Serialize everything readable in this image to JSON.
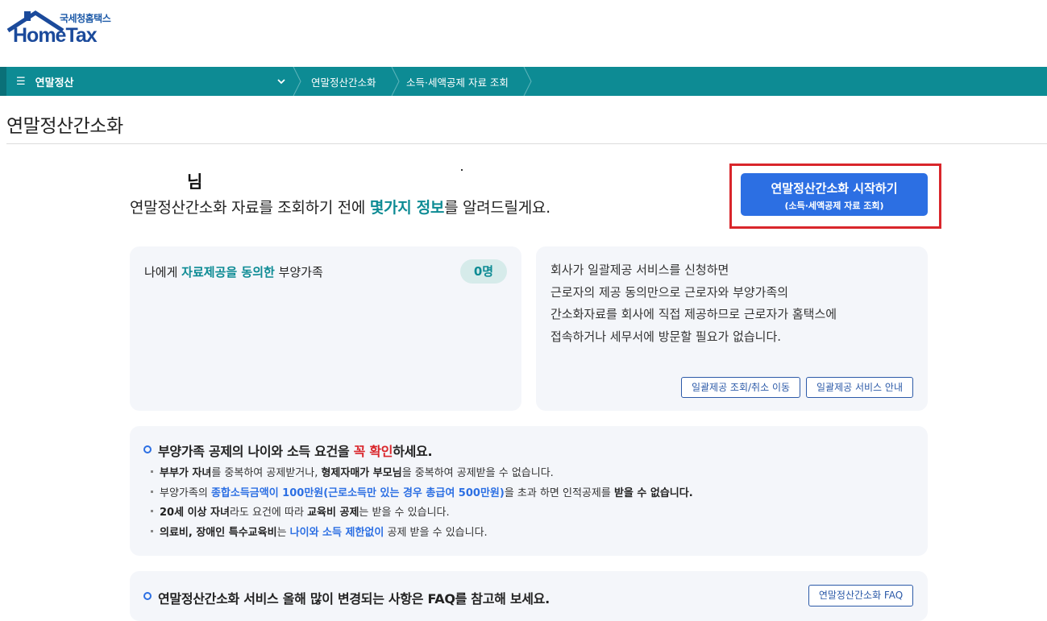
{
  "header": {
    "logo_sub": "국세청홈택스",
    "logo_main": "HomeTax"
  },
  "nav": {
    "menu_label": "연말정산",
    "breadcrumbs": [
      "연말정산간소화",
      "소득·세액공제 자료 조회"
    ]
  },
  "page": {
    "title": "연말정산간소화"
  },
  "greeting": {
    "name_suffix": "님",
    "line_pre": "연말정산간소화 자료를 조회하기 전에 ",
    "line_highlight": "몇가지 정보",
    "line_post": "를 알려드릴게요."
  },
  "start_button": {
    "label": "연말정산간소화 시작하기",
    "sublabel": "(소득·세액공제 자료 조회)"
  },
  "consent_card": {
    "label_pre": "나에게 ",
    "label_highlight": "자료제공을 동의한",
    "label_post": " 부양가족",
    "count": "0명"
  },
  "batch_card": {
    "lines": [
      "회사가 일괄제공 서비스를 신청하면",
      "근로자의 제공 동의만으로 근로자와 부양가족의",
      "간소화자료를 회사에 직접 제공하므로 근로자가 홈택스에",
      "접속하거나 세무서에 방문할 필요가 없습니다."
    ],
    "btn_query": "일괄제공 조회/취소 이동",
    "btn_guide": "일괄제공 서비스 안내"
  },
  "notice": {
    "title_pre": "부양가족 공제의 나이와 소득 요건을 ",
    "title_red": "꼭 확인",
    "title_post": "하세요.",
    "bullets": [
      {
        "b1": "부부가 자녀",
        "t1": "를 중복하여 공제받거나, ",
        "b2": "형제자매가 부모님",
        "t2": "을 중복하여 공제받을 수 없습니다."
      },
      {
        "t1": "부양가족의 ",
        "blue": "종합소득금액이 100만원(근로소득만 있는 경우 총급여 500만원)",
        "t2": "을 초과 하면 인적공제를 ",
        "b2": "받을 수 없습니다."
      },
      {
        "b1": "20세 이상 자녀",
        "t1": "라도 요건에 따라 ",
        "b2": "교육비 공제",
        "t2": "는 받을 수 있습니다."
      },
      {
        "b1": "의료비, 장애인 특수교육비",
        "t1": "는 ",
        "blue": "나이와 소득 제한없이",
        "t2": " 공제 받을 수 있습니다."
      }
    ]
  },
  "faq": {
    "text": "연말정산간소화 서비스 올해 많이 변경되는 사항은 FAQ를 참고해 보세요.",
    "button": "연말정산간소화 FAQ"
  },
  "colors": {
    "teal": "#0d8b94",
    "blue": "#2c6fe3",
    "red": "#d9262b"
  }
}
